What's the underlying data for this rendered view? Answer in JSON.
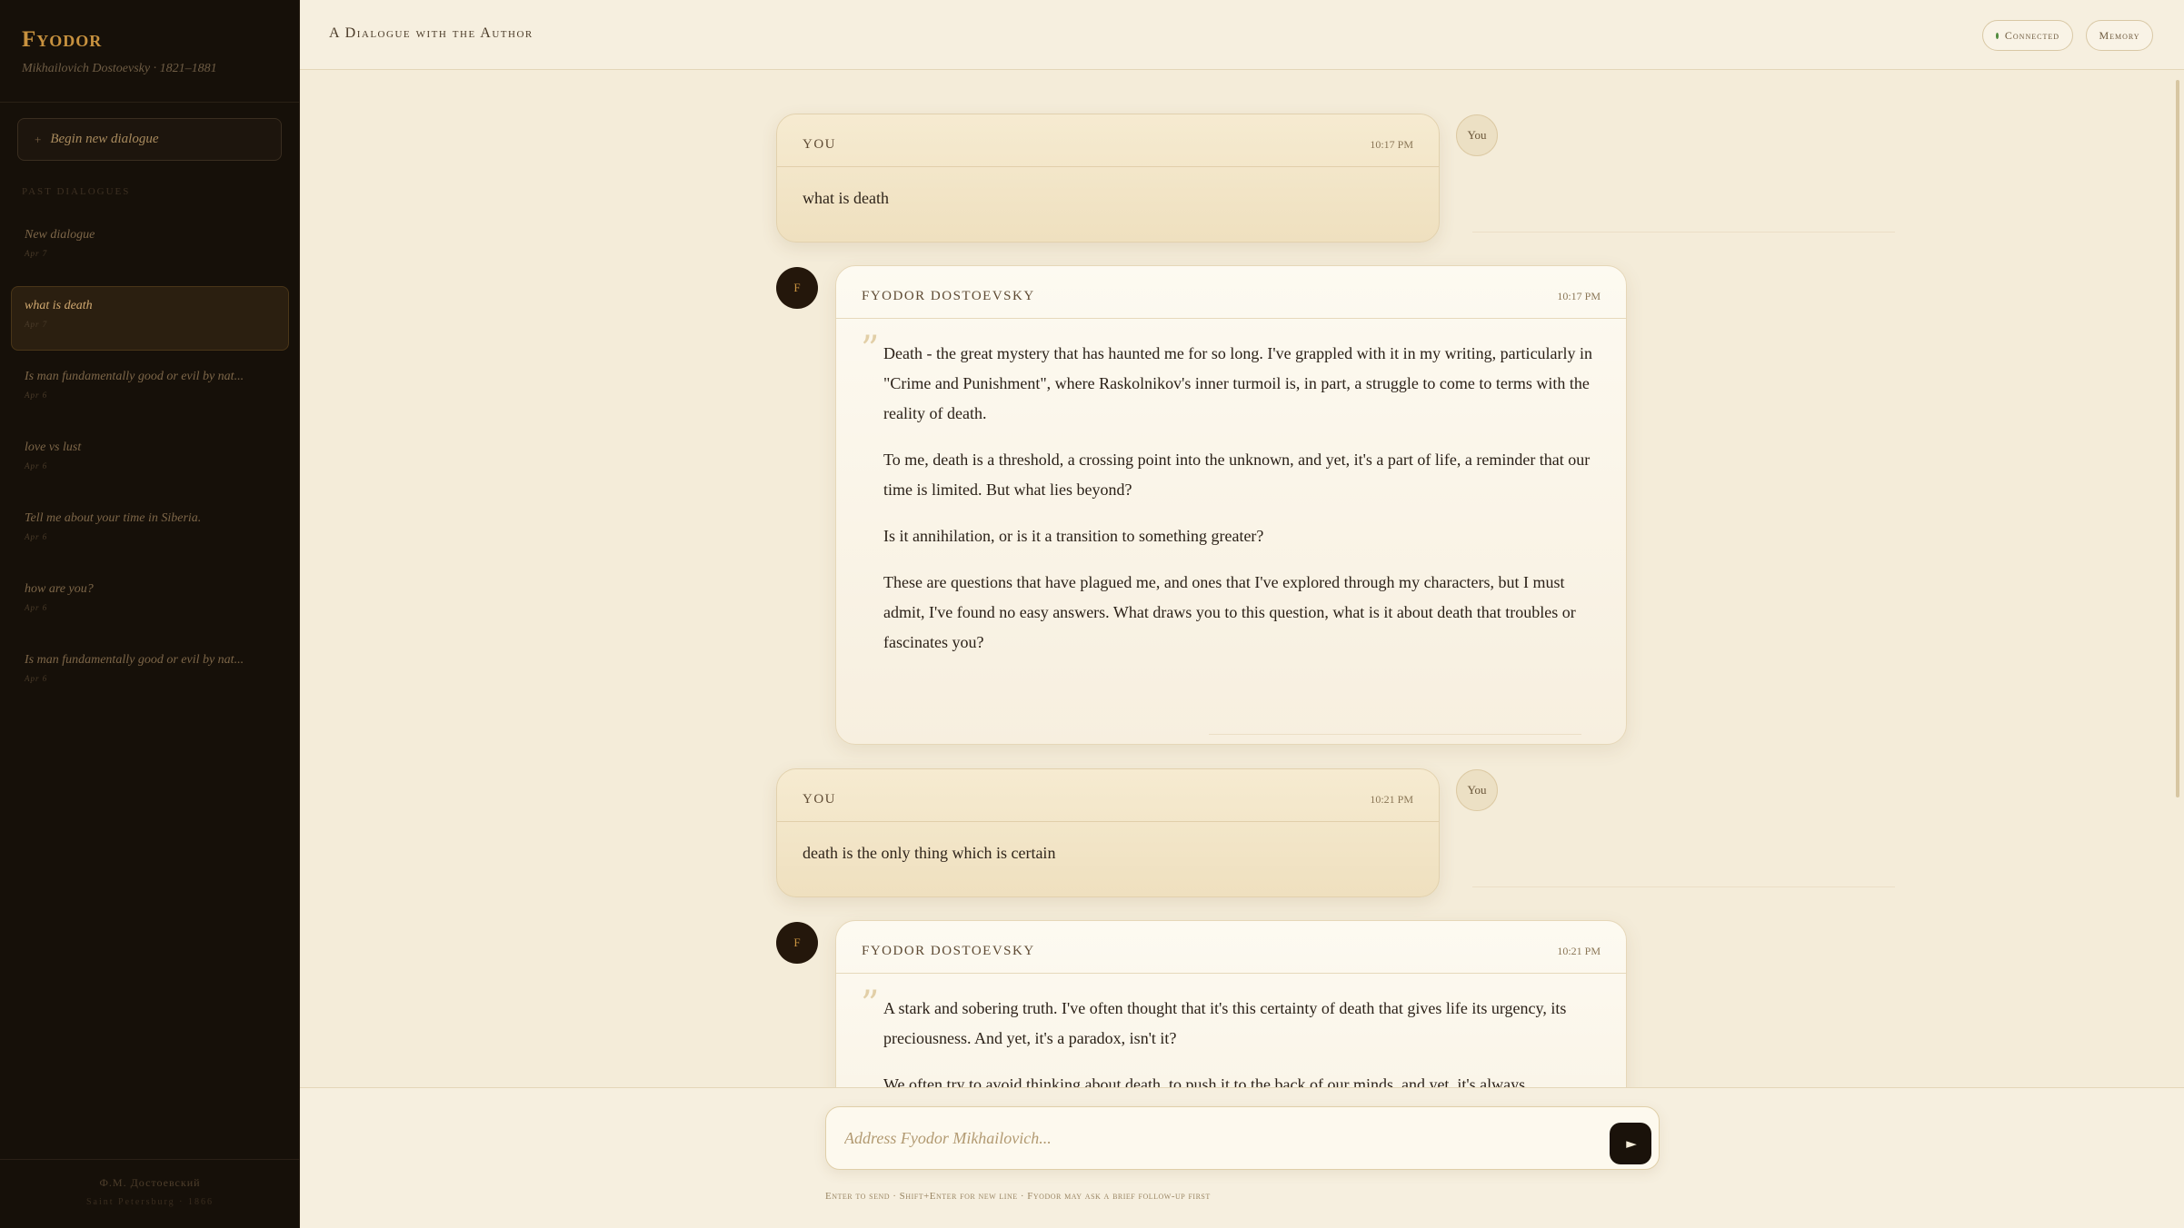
{
  "sidebar": {
    "brand_title": "Fyodor",
    "brand_subtitle": "Mikhailovich Dostoevsky · 1821–1881",
    "new_dialogue_label": "Begin new dialogue",
    "new_dialogue_icon": "+",
    "past_label": "PAST DIALOGUES",
    "dialogues": [
      {
        "title": "New dialogue",
        "date": "Apr 7"
      },
      {
        "title": "what is death",
        "date": "Apr 7"
      },
      {
        "title": "Is man fundamentally good or evil by nat...",
        "date": "Apr 6"
      },
      {
        "title": "love vs lust",
        "date": "Apr 6"
      },
      {
        "title": "Tell me about your time in Siberia.",
        "date": "Apr 6"
      },
      {
        "title": "how are you?",
        "date": "Apr 6"
      },
      {
        "title": "Is man fundamentally good or evil by nat...",
        "date": "Apr 6"
      }
    ],
    "footer_line1": "Ф.М. Достоевский",
    "footer_line2": "Saint Petersburg · 1866"
  },
  "header": {
    "title": "A Dialogue with the Author",
    "status_label": "Connected",
    "status_color": "#4f8a3c",
    "memory_label": "Memory"
  },
  "messages": [
    {
      "role": "YOU",
      "avatar": "You",
      "time": "10:17 PM",
      "text": "what is death"
    },
    {
      "role": "FYODOR DOSTOEVSKY",
      "avatar": "F",
      "time": "10:17 PM",
      "quote_icon": "”",
      "paragraphs": [
        "Death - the great mystery that has haunted me for so long. I've grappled with it in my writing, particularly in \"Crime and Punishment\", where Raskolnikov's inner turmoil is, in part, a struggle to come to terms with the reality of death.",
        "To me, death is a threshold, a crossing point into the unknown, and yet, it's a part of life, a reminder that our time is limited. But what lies beyond?",
        "Is it annihilation, or is it a transition to something greater?",
        "These are questions that have plagued me, and ones that I've explored through my characters, but I must admit, I've found no easy answers. What draws you to this question, what is it about death that troubles or fascinates you?"
      ]
    },
    {
      "role": "YOU",
      "avatar": "You",
      "time": "10:21 PM",
      "text": "death is the only thing which is certain"
    },
    {
      "role": "FYODOR DOSTOEVSKY",
      "avatar": "F",
      "time": "10:21 PM",
      "quote_icon": "”",
      "paragraphs": [
        "A stark and sobering truth. I've often thought that it's this certainty of death that gives life its urgency, its preciousness. And yet, it's a paradox, isn't it?",
        "We often try to avoid thinking about death, to push it to the back of our minds, and yet, it's always"
      ]
    }
  ],
  "composer": {
    "placeholder": "Address Fyodor Mikhailovich...",
    "send_icon": "send-arrow-icon",
    "hint": "Enter to send · Shift+Enter for new line · Fyodor may ask a brief follow-up first"
  },
  "colors": {
    "accent": "#c8923f",
    "sidebar_bg": "#161009",
    "page_bg": "#f4ecd9"
  }
}
